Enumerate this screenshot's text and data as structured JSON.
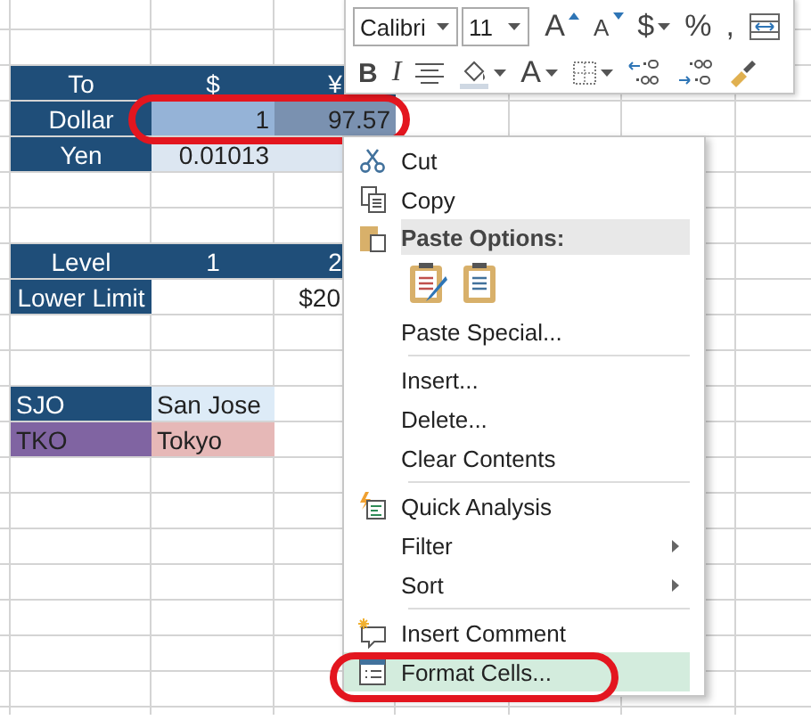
{
  "sheet": {
    "blocks": [
      {
        "rows": [
          {
            "cells": [
              {
                "text": "To",
                "color": "#1f4e79"
              },
              {
                "text": "$",
                "color": "#1f4e79"
              },
              {
                "text": "¥",
                "color": "#1f4e79"
              }
            ]
          },
          {
            "cells": [
              {
                "text": "Dollar",
                "color": "#1f4e79"
              },
              {
                "text": "1",
                "color": "#95b3d7"
              },
              {
                "text": "97.57",
                "color": "#7a91b0"
              }
            ]
          },
          {
            "cells": [
              {
                "text": "Yen",
                "color": "#1f4e79"
              },
              {
                "text": "0.01013",
                "color": "#dce6f1"
              },
              {
                "color": "#dce6f1"
              }
            ]
          }
        ]
      },
      {
        "rows": [
          {
            "cells": [
              {
                "text": "Level",
                "color": "#1f4e79"
              },
              {
                "text": "1",
                "color": "#1f4e79"
              },
              {
                "text": "2",
                "color": "#1f4e79"
              }
            ]
          },
          {
            "cells": [
              {
                "text": "Lower Limit",
                "color": "#1f4e79"
              },
              {},
              {
                "text": "$20"
              }
            ]
          }
        ]
      },
      {
        "rows": [
          {
            "cells": [
              {
                "text": "SJO",
                "color": "#1f4e79"
              },
              {
                "text": "San Jose",
                "color": "#ddebf7"
              }
            ]
          },
          {
            "cells": [
              {
                "text": "TKO",
                "color": "#8064a2"
              },
              {
                "text": "Tokyo",
                "color": "#e6b8b7"
              }
            ]
          }
        ]
      }
    ]
  },
  "mini_toolbar": {
    "font": "Calibri",
    "size": "11",
    "row1": [
      {
        "kind": "grow",
        "label": "A",
        "dropdown": false
      },
      {
        "kind": "shrink",
        "label": "A",
        "dropdown": false
      },
      {
        "kind": "text",
        "label": "$",
        "dropdown": true
      },
      {
        "kind": "text",
        "label": "%",
        "dropdown": false
      },
      {
        "kind": "text",
        "label": ",",
        "dropdown": false
      },
      {
        "kind": "merge",
        "dropdown": false
      }
    ],
    "row2": [
      {
        "kind": "bold",
        "label": "B",
        "dropdown": false
      },
      {
        "kind": "italic",
        "label": "I",
        "dropdown": false
      },
      {
        "kind": "align",
        "dropdown": false
      },
      {
        "kind": "fill",
        "dropdown": true
      },
      {
        "kind": "fontcolor",
        "label": "A",
        "dropdown": true
      },
      {
        "kind": "borders",
        "dropdown": true
      },
      {
        "kind": "incdecimal",
        "dropdown": false
      },
      {
        "kind": "decdecimal",
        "dropdown": false
      },
      {
        "kind": "painter",
        "dropdown": false
      }
    ]
  },
  "context_menu": {
    "items": [
      {
        "kind": "cut",
        "label": "Cut",
        "submenu": false,
        "selected": false
      },
      {
        "kind": "copy",
        "label": "Copy",
        "submenu": false,
        "selected": false
      },
      {
        "kind": "heading",
        "label": "Paste Options:"
      },
      {
        "kind": "pasteoptions"
      },
      {
        "kind": "plain",
        "label": "Paste Special...",
        "submenu": false,
        "selected": false
      },
      {
        "kind": "separator"
      },
      {
        "kind": "plain",
        "label": "Insert...",
        "submenu": false,
        "selected": false
      },
      {
        "kind": "plain",
        "label": "Delete...",
        "submenu": false,
        "selected": false
      },
      {
        "kind": "plain",
        "label": "Clear Contents",
        "submenu": false,
        "selected": false
      },
      {
        "kind": "separator"
      },
      {
        "kind": "analysis",
        "label": "Quick Analysis",
        "submenu": false,
        "selected": false
      },
      {
        "kind": "plain",
        "label": "Filter",
        "submenu": true,
        "selected": false
      },
      {
        "kind": "plain",
        "label": "Sort",
        "submenu": true,
        "selected": false
      },
      {
        "kind": "separator"
      },
      {
        "kind": "comment",
        "label": "Insert Comment",
        "submenu": false,
        "selected": false
      },
      {
        "kind": "format",
        "label": "Format Cells...",
        "submenu": false,
        "selected": true
      }
    ]
  }
}
